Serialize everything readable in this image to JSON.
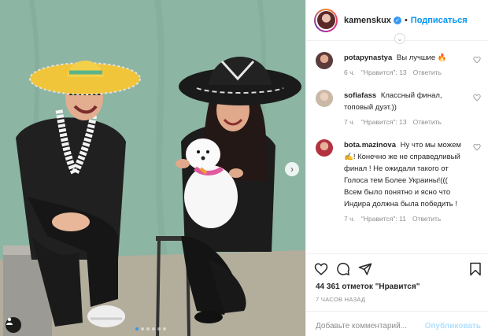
{
  "post": {
    "author": "kamenskux",
    "follow_label": "Подписаться",
    "separator": "•"
  },
  "comments": [
    {
      "username": "potapynastya",
      "text": "Вы лучшие 🔥",
      "time": "6 ч.",
      "likes": "\"Нравится\": 13",
      "reply": "Ответить",
      "avatar_color": "#5b3b3b"
    },
    {
      "username": "sofiafass",
      "text": "Классный финал, топовый дуэт.))",
      "time": "7 ч.",
      "likes": "\"Нравится\": 13",
      "reply": "Ответить",
      "avatar_color": "#c9b8a6"
    },
    {
      "username": "bota.mazinova",
      "text": "Ну что мы можем ✍️! Конечно же не справедливый финал ! Не ожидали такого от Голоса тем Более Украины!((( Всем было понятно и ясно что Индира должна была победить !",
      "time": "7 ч.",
      "likes": "\"Нравится\": 11",
      "reply": "Ответить",
      "avatar_color": "#b2333f"
    }
  ],
  "actions": {
    "likes_count": "44 361 отметок \"Нравится\"",
    "time_ago": "7 ЧАСОВ НАЗАД",
    "comment_placeholder": "Добавьте комментарий...",
    "publish_label": "Опубликовать"
  },
  "carousel": {
    "count": 6,
    "active_index": 0
  },
  "colors": {
    "accent": "#0095f6",
    "muted": "#8e8e8e",
    "border": "#efefef"
  },
  "icons": [
    "chevron-right-icon",
    "user-tag-icon",
    "verified-icon",
    "heart-icon",
    "comment-icon",
    "share-icon",
    "bookmark-icon",
    "more-icon"
  ]
}
